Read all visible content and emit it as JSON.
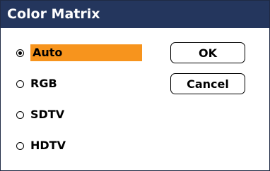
{
  "dialog": {
    "title": "Color Matrix"
  },
  "options": [
    {
      "label": "Auto",
      "selected": true
    },
    {
      "label": "RGB",
      "selected": false
    },
    {
      "label": "SDTV",
      "selected": false
    },
    {
      "label": "HDTV",
      "selected": false
    }
  ],
  "buttons": {
    "ok_label": "OK",
    "cancel_label": "Cancel"
  },
  "colors": {
    "titlebar": "#24365d",
    "highlight": "#f7941d"
  }
}
